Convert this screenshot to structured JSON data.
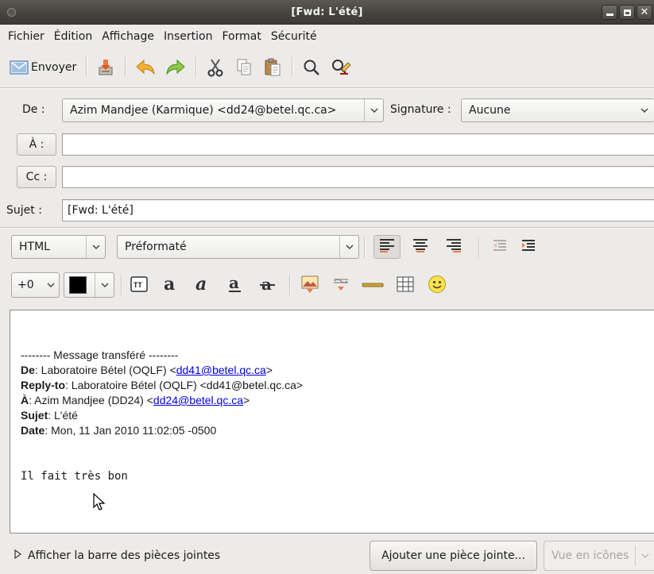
{
  "window": {
    "title": "[Fwd: L'été]"
  },
  "menu": {
    "items": [
      "Fichier",
      "Édition",
      "Affichage",
      "Insertion",
      "Format",
      "Sécurité"
    ]
  },
  "toolbar": {
    "send_label": "Envoyer",
    "icons": [
      "save-icon",
      "undo-icon",
      "redo-icon",
      "cut-icon",
      "copy-icon",
      "paste-icon",
      "find-icon",
      "spellcheck-icon"
    ]
  },
  "header": {
    "from_label": "De :",
    "from_value": "Azim Mandjee (Karmique) <dd24@betel.qc.ca>",
    "signature_label": "Signature :",
    "signature_value": "Aucune",
    "to_label": "À :",
    "to_value": "",
    "cc_label": "Cc :",
    "cc_value": "",
    "subject_label": "Sujet :",
    "subject_value": "[Fwd: L'été]"
  },
  "format": {
    "mode": "HTML",
    "paragraph_style": "Préformaté",
    "font_size": "+0",
    "text_color": "#000000"
  },
  "message": {
    "separator": "-------- Message transféré --------",
    "from_label": "De",
    "from_text": ": Laboratoire Bétel (OQLF) <",
    "from_link": "dd41@betel.qc.ca",
    "from_close": ">",
    "replyto_label": "Reply-to",
    "replyto_text": ": Laboratoire Bétel (OQLF) <dd41@betel.qc.ca>",
    "to_label": "À",
    "to_text": ": Azim Mandjee (DD24) <",
    "to_link": "dd24@betel.qc.ca",
    "to_close": ">",
    "subject_label": "Sujet",
    "subject_text": ": L'été",
    "date_label": "Date",
    "date_text": ": Mon, 11 Jan 2010 11:02:05 -0500",
    "body": "Il fait très bon"
  },
  "bottom": {
    "attachments_toggle": "Afficher la barre des pièces jointes",
    "attach_button": "Ajouter une pièce jointe...",
    "view_mode": "Vue en icônes"
  },
  "colors": {
    "titlebar": "#3c3b37",
    "window_bg": "#edebe9",
    "link": "#0000ee",
    "accent_orange": "#f07746"
  }
}
